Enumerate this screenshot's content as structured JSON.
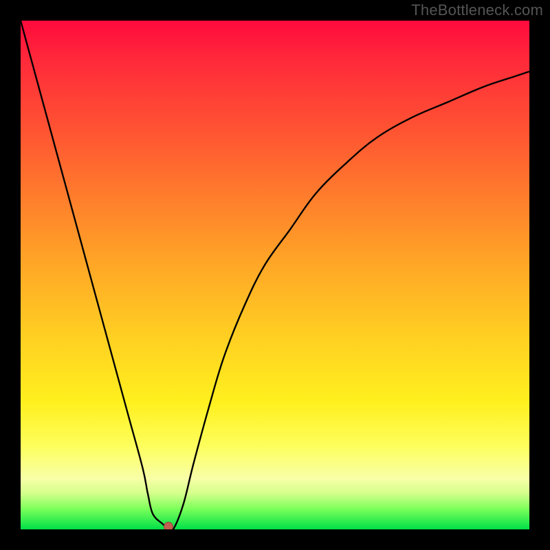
{
  "watermark": "TheBottleneck.com",
  "colors": {
    "frame": "#000000",
    "curve_stroke": "#000000",
    "marker_fill": "#c06050",
    "gradient_stops": [
      "#ff0a3c",
      "#ff2a3a",
      "#ff5532",
      "#ff7e2c",
      "#ffa726",
      "#ffcf22",
      "#fff01e",
      "#fdff60",
      "#f8ffa8",
      "#d3ff8a",
      "#7aff5a",
      "#00e048"
    ]
  },
  "chart_data": {
    "type": "line",
    "title": "",
    "xlabel": "",
    "ylabel": "",
    "xlim": [
      0,
      100
    ],
    "ylim": [
      0,
      100
    ],
    "x": [
      0,
      3,
      6,
      9,
      12,
      15,
      18,
      21,
      24,
      25,
      26,
      28,
      29,
      30,
      32,
      34,
      37,
      40,
      44,
      48,
      53,
      58,
      64,
      70,
      77,
      84,
      91,
      97,
      100
    ],
    "values": [
      100,
      89,
      78,
      67,
      56,
      45,
      34,
      23,
      12,
      7,
      3,
      1,
      0,
      0,
      5,
      13,
      24,
      34,
      44,
      52,
      59,
      66,
      72,
      77,
      81,
      84,
      87,
      89,
      90
    ],
    "marker": {
      "x": 29,
      "y": 0.5
    },
    "legend": []
  }
}
